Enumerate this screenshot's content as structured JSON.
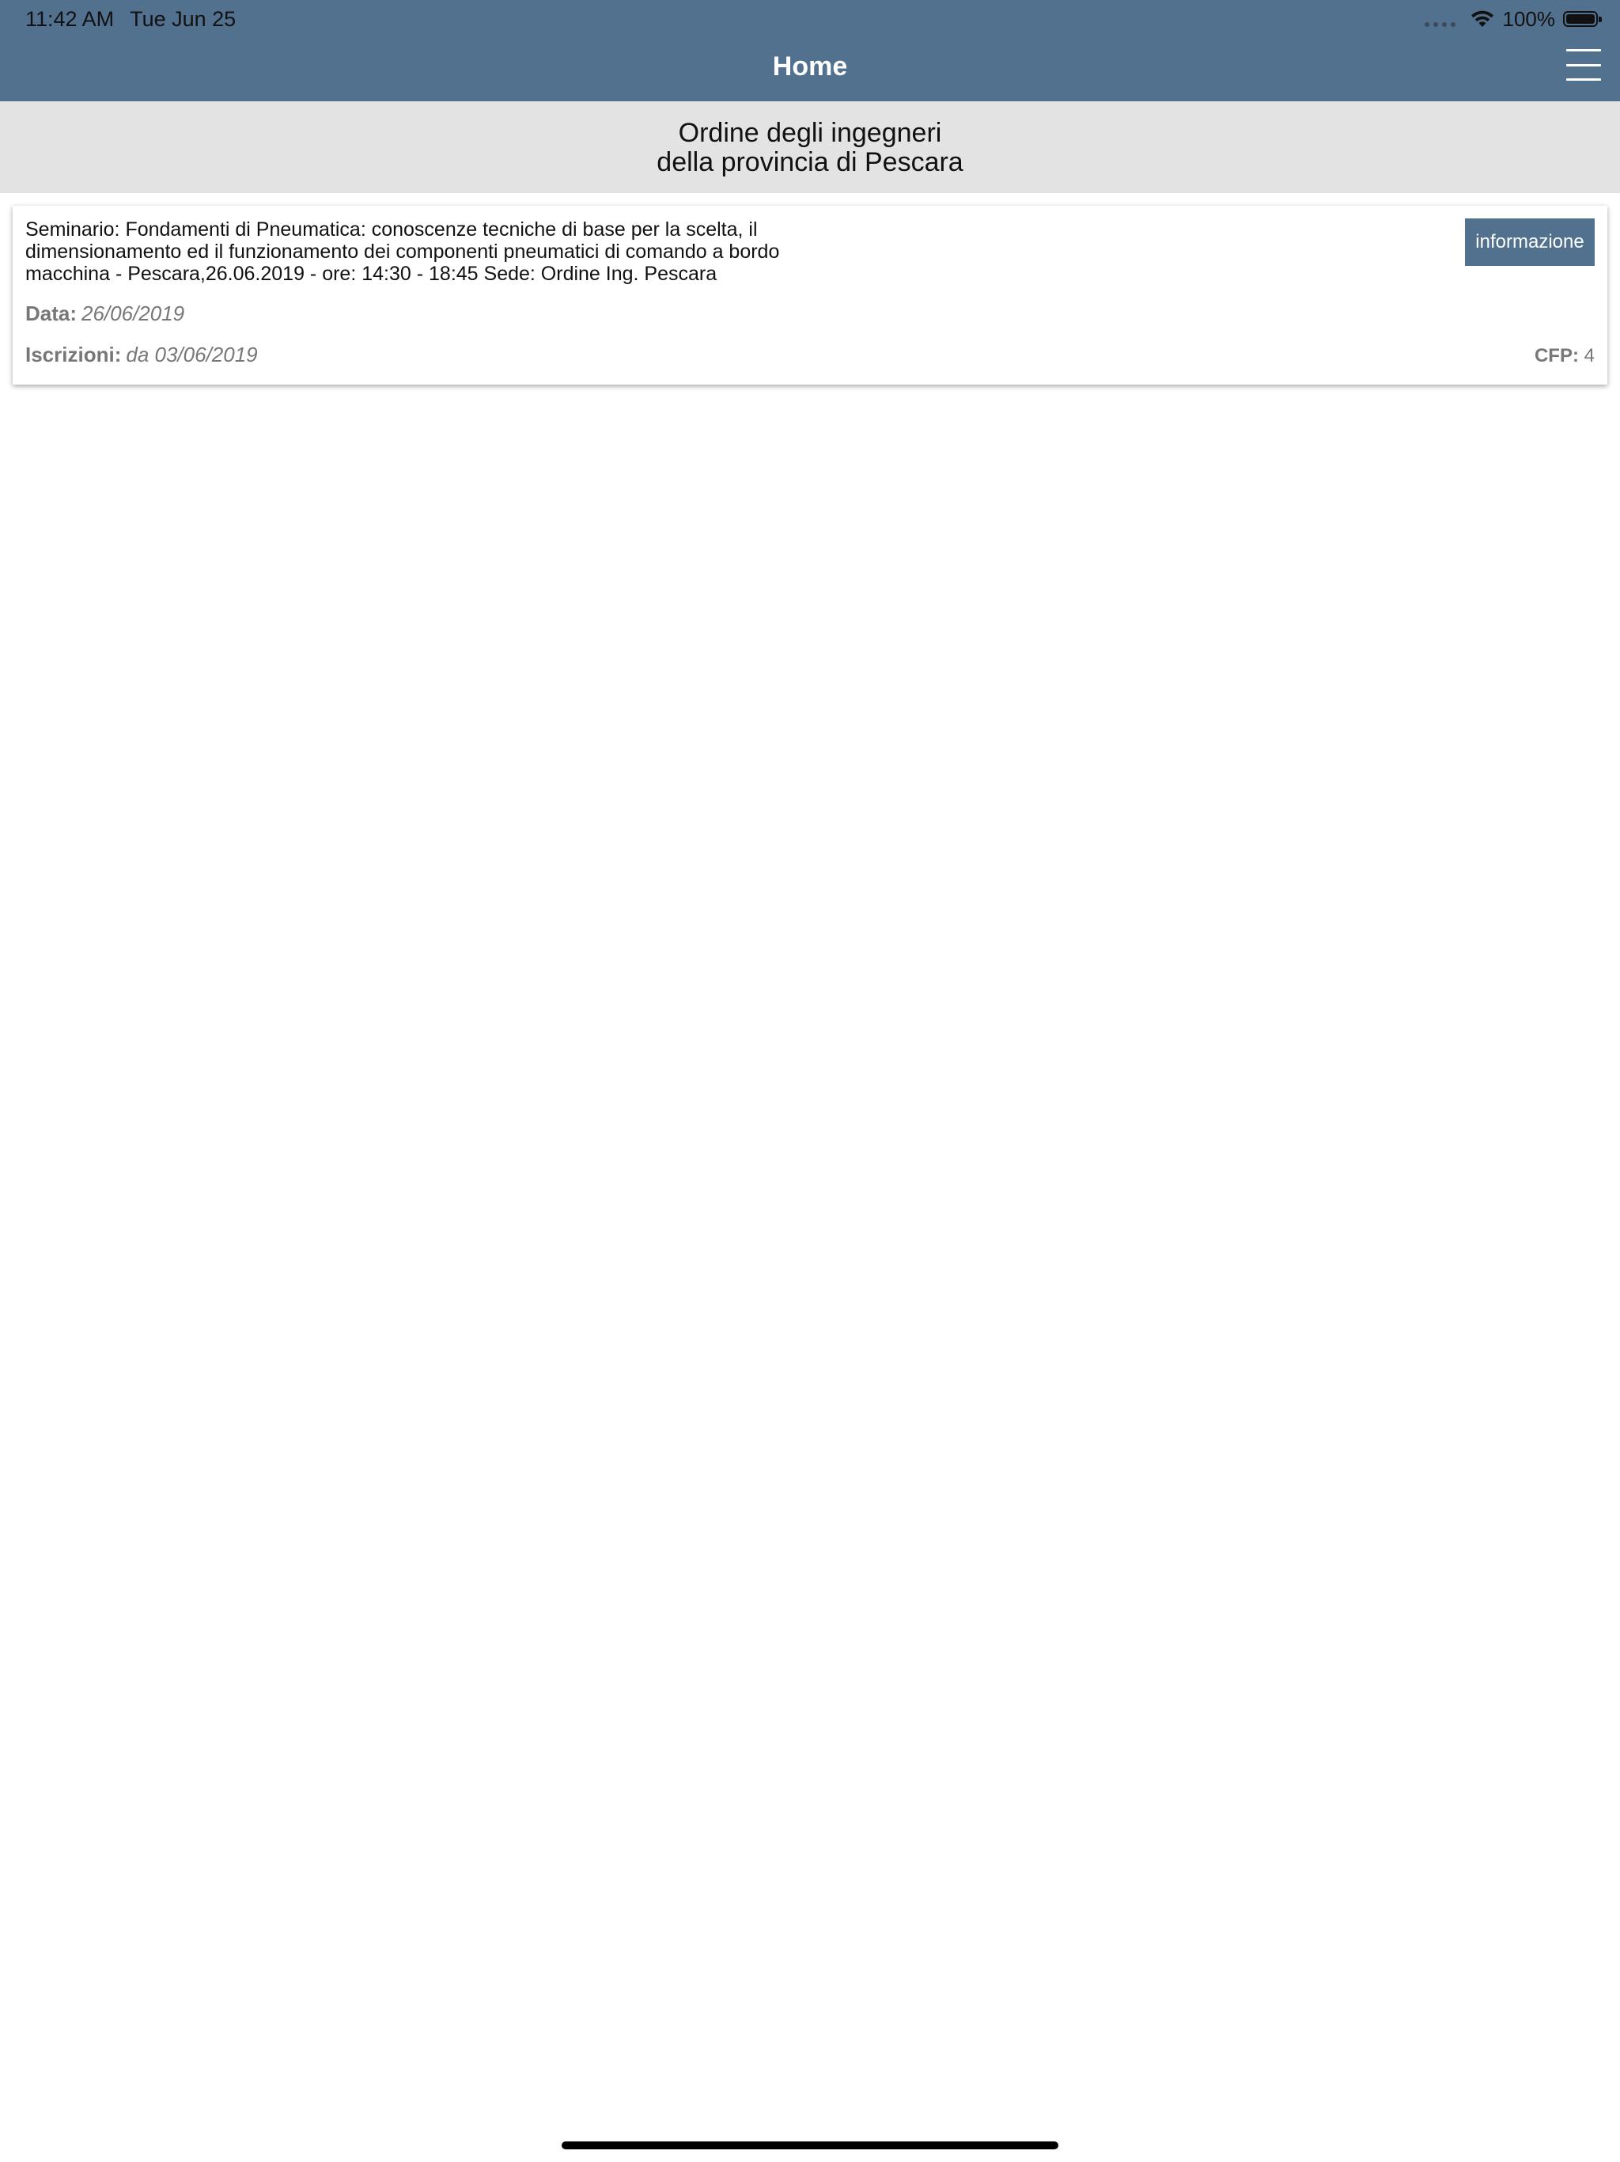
{
  "status_bar": {
    "time": "11:42 AM",
    "date": "Tue Jun 25",
    "battery_percent": "100%",
    "battery_level": 1.0,
    "icons": [
      "signal-dots-icon",
      "wifi-icon",
      "battery-icon"
    ]
  },
  "nav": {
    "title": "Home",
    "menu_icon": "hamburger-menu-icon"
  },
  "org": {
    "line1": "Ordine degli ingegneri",
    "line2": "della provincia di Pescara"
  },
  "events": [
    {
      "title": "Seminario: Fondamenti di Pneumatica: conoscenze tecniche di base per la scelta, il dimensionamento ed il funzionamento dei componenti pneumatici di comando a bordo macchina - Pescara,26.06.2019 - ore: 14:30 - 18:45  Sede: Ordine  Ing. Pescara",
      "info_button": "informazione",
      "date_label": "Data:",
      "date_value": "26/06/2019",
      "iscrizioni_label": "Iscrizioni:",
      "iscrizioni_value": "da 03/06/2019",
      "cfp_label": "CFP:",
      "cfp_value": "4"
    }
  ],
  "colors": {
    "nav_bg": "#52718f",
    "header_bg": "#e3e3e3",
    "meta_text": "#777777"
  }
}
